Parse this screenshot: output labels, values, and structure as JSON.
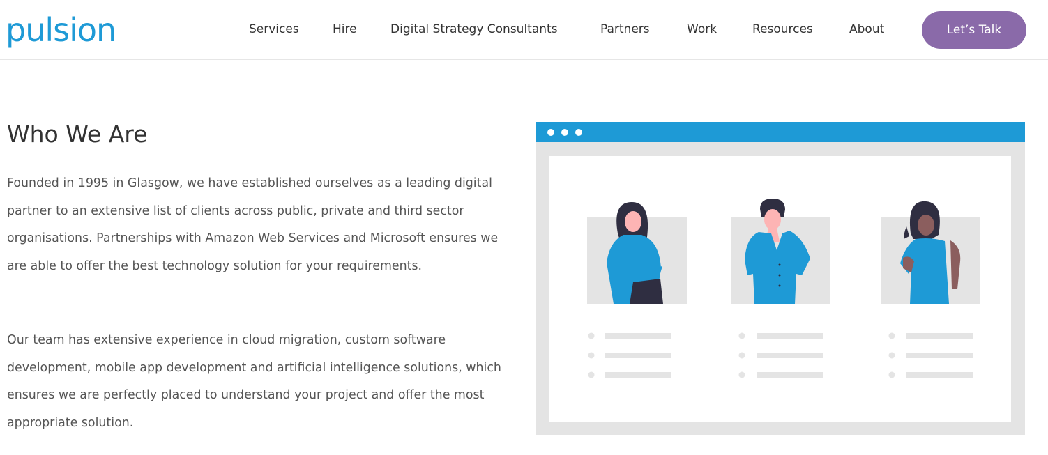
{
  "brand": {
    "logo_text": "pulsion"
  },
  "nav": {
    "items": [
      "Services",
      "Hire",
      "Digital Strategy Consultants",
      "Partners",
      "Work",
      "Resources",
      "About"
    ],
    "cta_label": "Let’s Talk"
  },
  "main": {
    "title": "Who We Are",
    "paragraphs": [
      "Founded in 1995 in Glasgow, we have established ourselves as a leading digital partner to an extensive list of clients across public, private and third sector organisations. Partnerships with Amazon Web Services and Microsoft ensures we are able to offer the best technology solution for your requirements.",
      "Our team has extensive experience in cloud migration, custom software development, mobile app development and artificial intelligence solutions, which ensures we are perfectly placed to understand your project and offer the most appropriate solution."
    ]
  },
  "colors": {
    "brand_blue": "#1e9ad6",
    "cta_purple": "#8a6aa9"
  }
}
